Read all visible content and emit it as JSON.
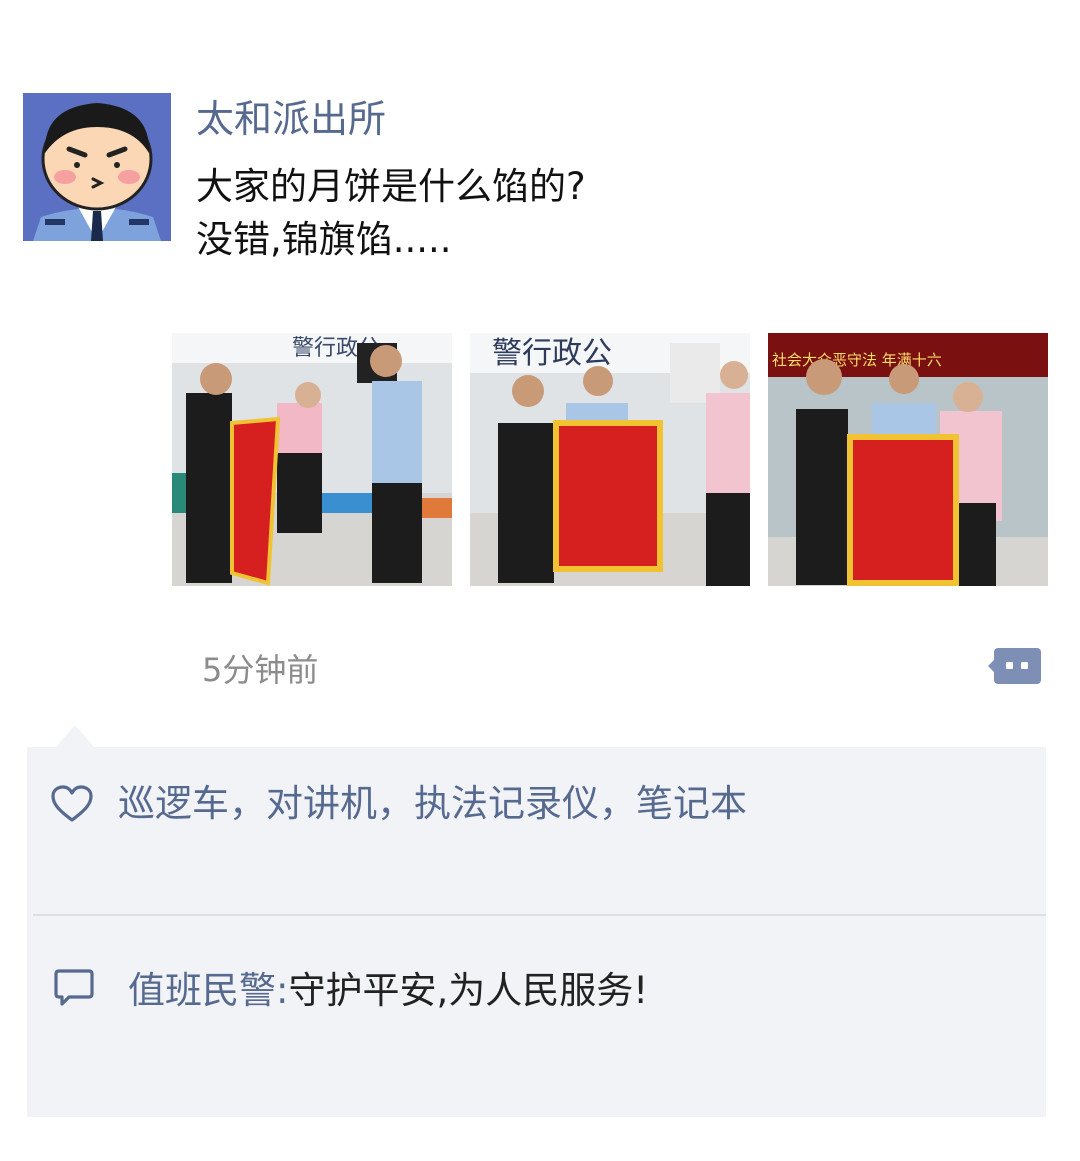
{
  "post": {
    "author": "太和派出所",
    "lines": [
      "大家的月饼是什么馅的?",
      "没错,锦旗馅....."
    ],
    "time": "5分钟前",
    "photos": [
      {
        "name": "photo-1",
        "banner": "警行政公"
      },
      {
        "name": "photo-2",
        "banner": "警行政公"
      },
      {
        "name": "photo-3",
        "banner": "社会大众恶守法   年满十六"
      }
    ]
  },
  "likes": {
    "text": "巡逻车，对讲机，执法记录仪，笔记本"
  },
  "comments": [
    {
      "author": "值班民警",
      "separator": ":",
      "text": "守护平安,为人民服务!"
    }
  ],
  "icons": {
    "like": "heart-outline-icon",
    "comment": "comment-bubble-icon",
    "more": "more-dots-icon"
  },
  "colors": {
    "link": "#56698f",
    "panel": "#f2f3f6",
    "pennant": "#d6201f",
    "pennant_trim": "#f1c232"
  }
}
